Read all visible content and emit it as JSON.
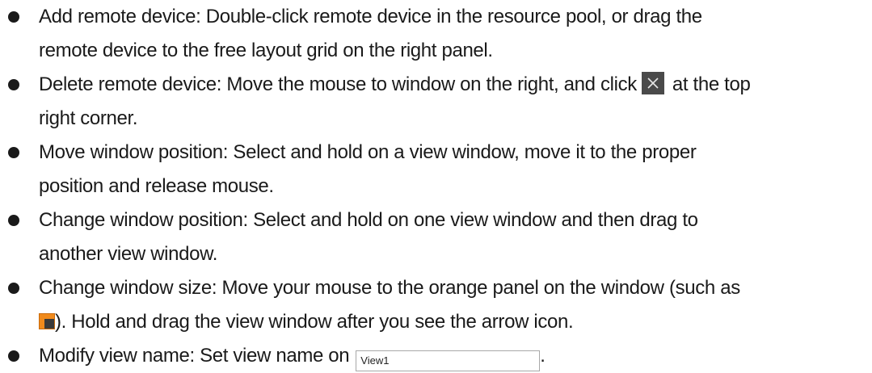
{
  "items": [
    {
      "line1": "Add remote device: Double-click remote device in the resource pool, or drag the",
      "line2": "remote device to the free layout grid on the right panel."
    },
    {
      "line1_before_icon": "Delete remote device: Move the mouse to window on the right, and click",
      "line1_after_icon": "at the top",
      "line2": "right corner.",
      "icon": "close-icon"
    },
    {
      "line1": "Move window position: Select and hold on a view window, move it to the proper",
      "line2": "position and release mouse."
    },
    {
      "line1": "Change window position: Select and hold on one view window and then drag to",
      "line2": "another view window."
    },
    {
      "line1": "Change window size: Move your mouse to the orange panel on the window (such as",
      "line2_after_icon": "). Hold and drag the view window after you see the arrow icon.",
      "icon": "orange-resize-icon"
    },
    {
      "line1_before_input": "Modify view name: Set view name on",
      "input_value": "View1",
      "line1_after_input": "."
    }
  ],
  "colors": {
    "text": "#1a1a1a",
    "close_icon_bg": "#4a4a4a",
    "orange_panel": "#f08a1c",
    "input_border": "#a8a8a8"
  }
}
